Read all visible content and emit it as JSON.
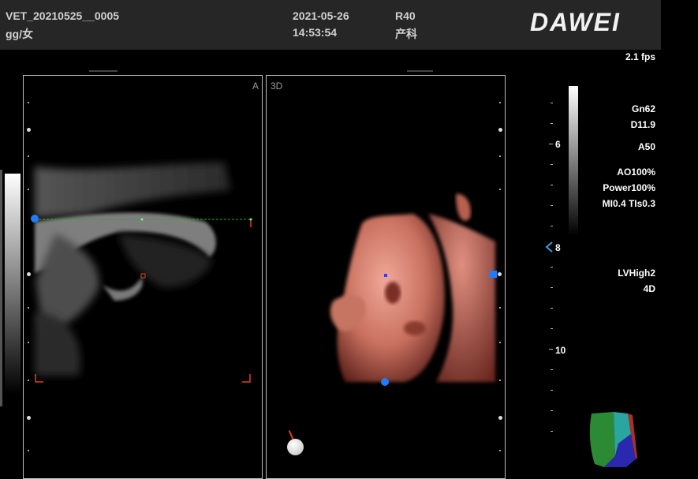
{
  "header": {
    "patient_id": "VET_20210525__0005",
    "patient_info": "gg/女",
    "date": "2021-05-26",
    "time": "14:53:54",
    "probe": "R40",
    "preset": "产科",
    "brand": "DAWEI"
  },
  "frame_rate": "2.1 fps",
  "params": {
    "gain": "Gn62",
    "depth": "D11.9",
    "angle": "A50",
    "ao": "AO100%",
    "power": "Power100%",
    "mi_ti": "MI0.4 TIs0.3",
    "render_mode": "LVHigh2",
    "mode": "4D"
  },
  "viewports": {
    "a_label": "A",
    "d3_label": "3D"
  },
  "depth_scale": {
    "labels": [
      "6",
      "8",
      "10"
    ]
  },
  "colors": {
    "header_bg": "#262626",
    "cursor_blue": "#1f7bff",
    "skin_tone": "#d8897a",
    "roi_red": "#e04020"
  }
}
